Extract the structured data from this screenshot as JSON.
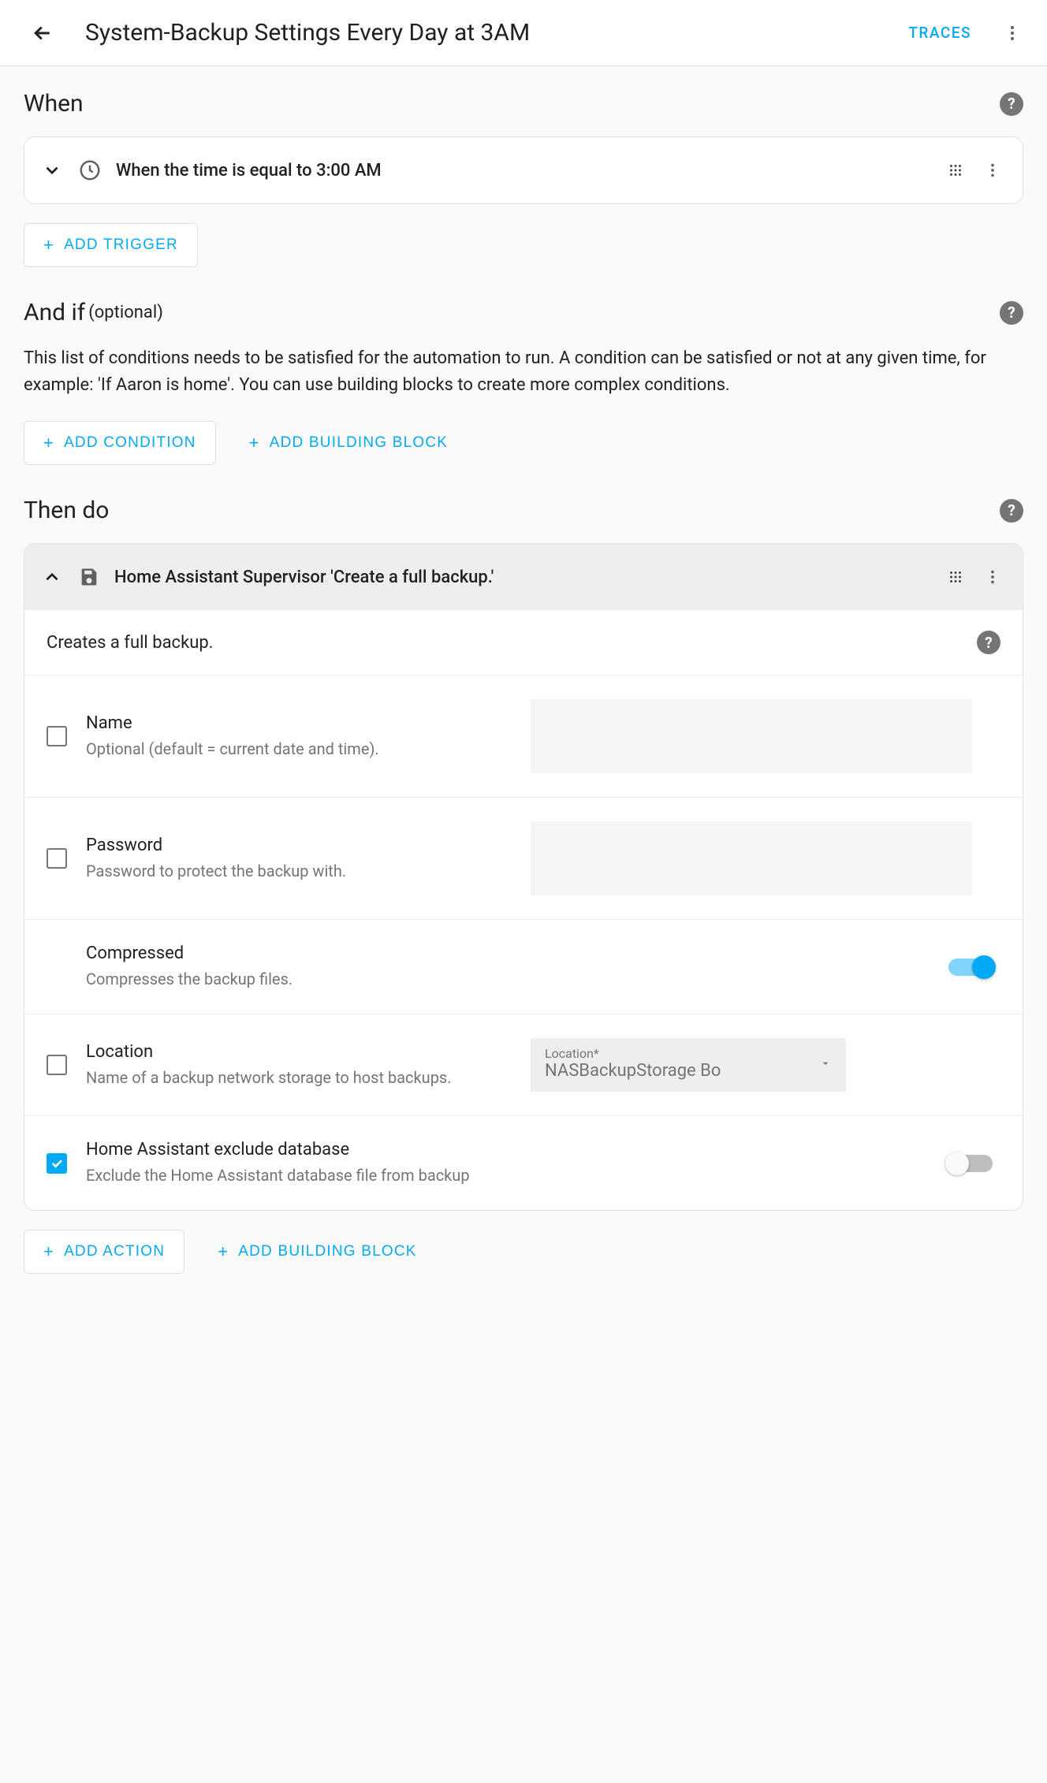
{
  "header": {
    "title": "System-Backup Settings Every Day at 3AM",
    "traces_label": "TRACES"
  },
  "when": {
    "heading": "When",
    "trigger_title": "When the time is equal to 3:00 AM",
    "add_trigger_label": "ADD TRIGGER"
  },
  "andif": {
    "heading": "And if",
    "optional": "(optional)",
    "description": "This list of conditions needs to be satisfied for the automation to run. A condition can be satisfied or not at any given time, for example: 'If Aaron is home'. You can use building blocks to create more complex conditions.",
    "add_condition_label": "ADD CONDITION",
    "add_block_label": "ADD BUILDING BLOCK"
  },
  "thendo": {
    "heading": "Then do",
    "action_title": "Home Assistant Supervisor 'Create a full backup.'",
    "action_desc": "Creates a full backup.",
    "params": {
      "name": {
        "label": "Name",
        "desc": "Optional (default = current date and time)."
      },
      "password": {
        "label": "Password",
        "desc": "Password to protect the backup with."
      },
      "compressed": {
        "label": "Compressed",
        "desc": "Compresses the backup files."
      },
      "location": {
        "label": "Location",
        "desc": "Name of a backup network storage to host backups.",
        "field_label": "Location*",
        "value": "NASBackupStorage Bo"
      },
      "exclude_db": {
        "label": "Home Assistant exclude database",
        "desc": "Exclude the Home Assistant database file from backup"
      }
    },
    "add_action_label": "ADD ACTION",
    "add_block_label": "ADD BUILDING BLOCK"
  }
}
